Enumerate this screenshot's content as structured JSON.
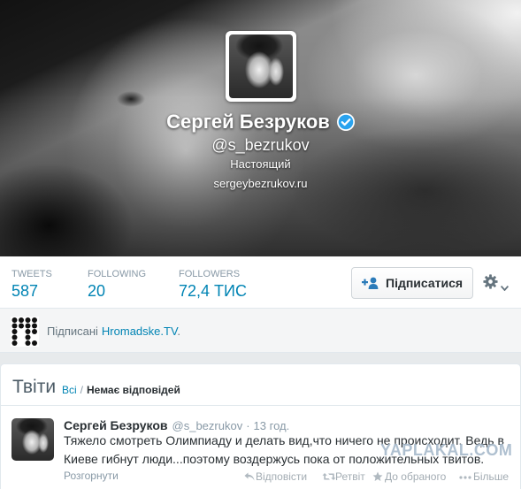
{
  "profile": {
    "name": "Сергей Безруков",
    "handle": "@s_bezrukov",
    "bio": "Настоящий",
    "url": "sergeybezrukov.ru",
    "verified": true
  },
  "stats": [
    {
      "label": "TWEETS",
      "value": "587"
    },
    {
      "label": "FOLLOWING",
      "value": "20"
    },
    {
      "label": "FOLLOWERS",
      "value": "72,4 ТИС"
    }
  ],
  "follow_button": {
    "label": "Підписатися"
  },
  "followed_by": {
    "prefix": "Підписані",
    "account": "Hromadske.TV",
    "suffix": "."
  },
  "timeline": {
    "title": "Твіти",
    "filter_all": "Всі",
    "separator": "/",
    "filter_no_replies": "Немає відповідей"
  },
  "tweet": {
    "author_name": "Сергей Безруков",
    "author_handle": "@s_bezrukov",
    "dot": "·",
    "time": "13 год.",
    "text": "Тяжело смотреть Олимпиаду и делать вид,что ничего не происходит. Ведь в Киеве гибнут люди...поэтому воздержусь пока от положительных твитов.",
    "expand": "Розгорнути",
    "actions": {
      "reply": "Відповісти",
      "retweet": "Ретвіт",
      "favorite": "До обраного",
      "more": "Більше"
    }
  },
  "watermark": "YAPLAKAL.COM",
  "icons": {
    "verified": "verified-badge-icon",
    "follow": "person-plus-icon",
    "settings": "gear-icon",
    "settings_menu": "chevron-down-icon",
    "followed_by_logo": "hromadske-logo-icon",
    "reply": "reply-icon",
    "retweet": "retweet-icon",
    "favorite": "star-icon",
    "more": "more-dots-icon"
  },
  "colors": {
    "link": "#0084b4",
    "text": "#292f33",
    "muted": "#8899a6",
    "verified": "#2aa3ef",
    "follow_icon": "#2b7bb9"
  }
}
